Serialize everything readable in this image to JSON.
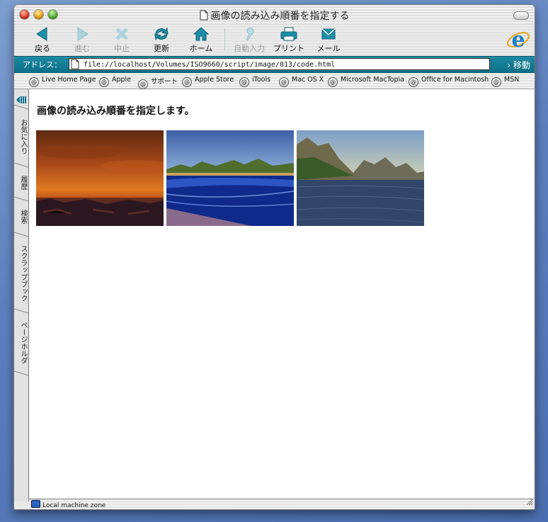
{
  "window": {
    "title": "画像の読み込み順番を指定する"
  },
  "toolbar": {
    "back": "戻る",
    "forward": "進む",
    "stop": "中止",
    "refresh": "更新",
    "home": "ホーム",
    "autofill": "自動入力",
    "print": "プリント",
    "mail": "メール"
  },
  "address": {
    "label": "アドレス：",
    "url": "file://localhost/Volumes/ISO9660/script/image/013/code.html",
    "go": "移動"
  },
  "favorites": [
    "Live Home Page",
    "Apple",
    "サポート",
    "Apple Store",
    "iTools",
    "Mac OS X",
    "Microsoft MacTopia",
    "Office for Macintosh",
    "MSN"
  ],
  "sidebar_tabs": [
    "お気に入り",
    "履歴",
    "検索",
    "スクラップブック",
    "ページホルダ"
  ],
  "page": {
    "heading": "画像の読み込み順番を指定します。"
  },
  "status": {
    "zone": "Local machine zone"
  }
}
